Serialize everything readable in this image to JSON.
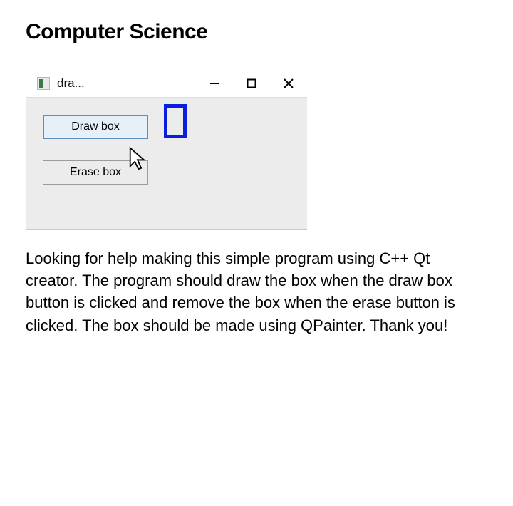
{
  "heading": "Computer Science",
  "window": {
    "title": "dra...",
    "buttons": {
      "draw": "Draw box",
      "erase": "Erase box"
    }
  },
  "question_text": "Looking for help making this simple program using C++ Qt creator. The program should draw the box when the draw box button is clicked and remove the box when the erase button is clicked. The box should be made using QPainter. Thank you!"
}
